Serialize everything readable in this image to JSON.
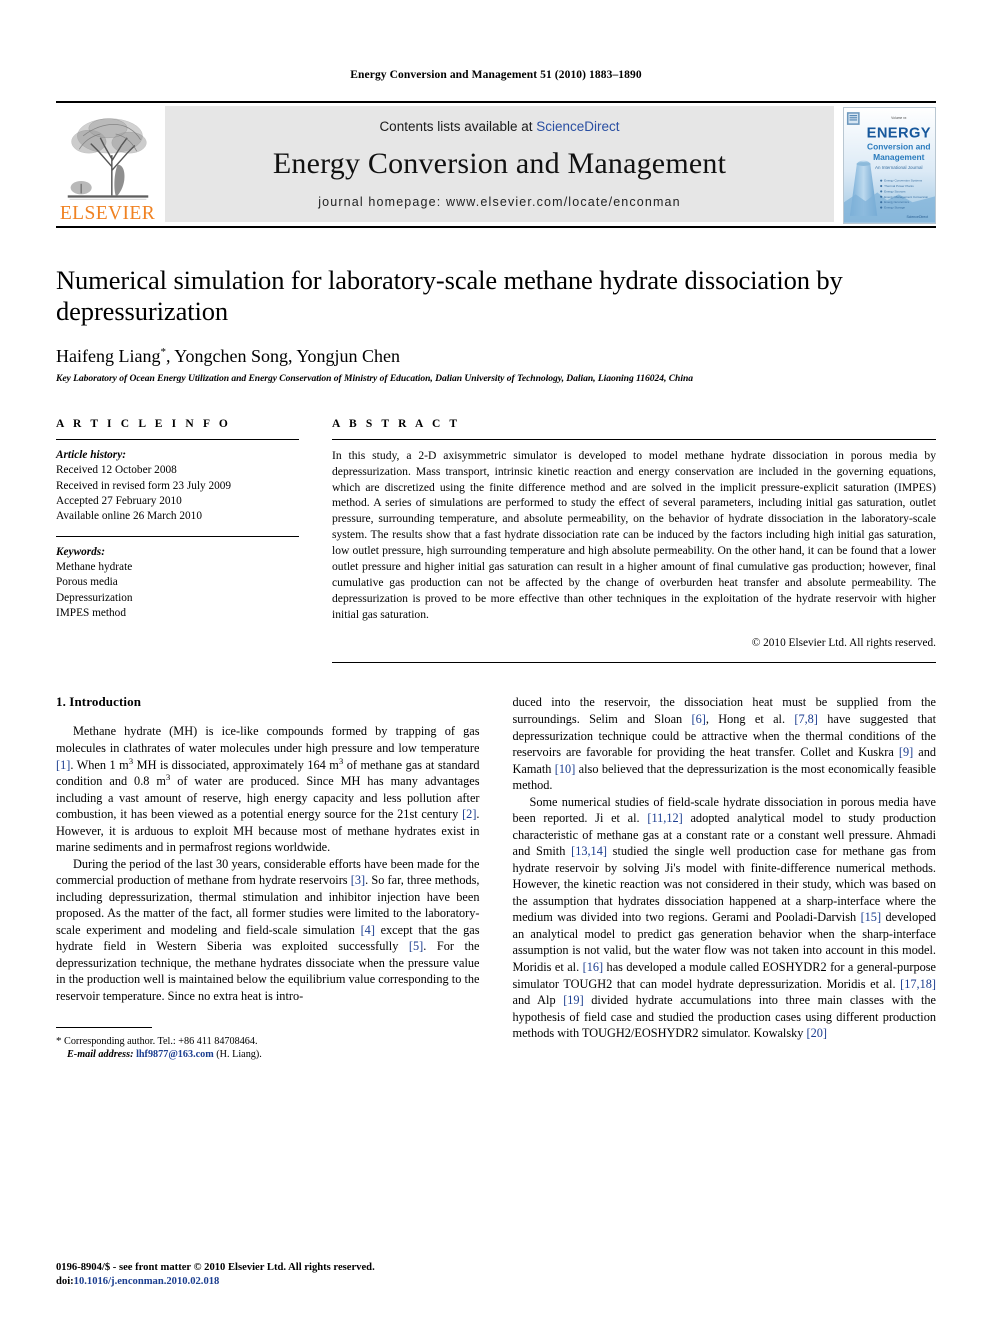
{
  "running_head": "Energy Conversion and Management 51 (2010) 1883–1890",
  "masthead": {
    "publisher_name": "ELSEVIER",
    "contents_prefix": "Contents lists available at ",
    "contents_link": "ScienceDirect",
    "journal_title": "Energy Conversion and Management",
    "homepage": "journal homepage: www.elsevier.com/locate/enconman",
    "cover": {
      "top_label": "Volume xx",
      "line1": "ENERGY",
      "line2": "Conversion and",
      "line3": "Management",
      "subtitle": "An International Journal",
      "footer": "ScienceDirect",
      "accent": "#1d6fb8"
    },
    "link_color": "#2a4fa2",
    "elsevier_orange": "#F08222"
  },
  "title": "Numerical simulation for laboratory-scale methane hydrate dissociation by depressurization",
  "authors": "Haifeng Liang",
  "authors_rest": ", Yongchen Song, Yongjun Chen",
  "author_star": "*",
  "affiliation": "Key Laboratory of Ocean Energy Utilization and Energy Conservation of Ministry of Education, Dalian University of Technology, Dalian, Liaoning 116024, China",
  "article_info": {
    "heading": "A R T I C L E   I N F O",
    "history_label": "Article history:",
    "history": [
      "Received 12 October 2008",
      "Received in revised form 23 July 2009",
      "Accepted 27 February 2010",
      "Available online 26 March 2010"
    ],
    "keywords_label": "Keywords:",
    "keywords": [
      "Methane hydrate",
      "Porous media",
      "Depressurization",
      "IMPES method"
    ]
  },
  "abstract": {
    "heading": "A B S T R A C T",
    "text": "In this study, a 2-D axisymmetric simulator is developed to model methane hydrate dissociation in porous media by depressurization. Mass transport, intrinsic kinetic reaction and energy conservation are included in the governing equations, which are discretized using the finite difference method and are solved in the implicit pressure-explicit saturation (IMPES) method. A series of simulations are performed to study the effect of several parameters, including initial gas saturation, outlet pressure, surrounding temperature, and absolute permeability, on the behavior of hydrate dissociation in the laboratory-scale system. The results show that a fast hydrate dissociation rate can be induced by the factors including high initial gas saturation, low outlet pressure, high surrounding temperature and high absolute permeability. On the other hand, it can be found that a lower outlet pressure and higher initial gas saturation can result in a higher amount of final cumulative gas production; however, final cumulative gas production can not be affected by the change of overburden heat transfer and absolute permeability. The depressurization is proved to be more effective than other techniques in the exploitation of the hydrate reservoir with higher initial gas saturation.",
    "copyright": "© 2010 Elsevier Ltd. All rights reserved."
  },
  "section": {
    "number_title": "1. Introduction"
  },
  "left_column": {
    "p1_a": "Methane hydrate (MH) is ice-like compounds formed by trapping of gas molecules in clathrates of water molecules under high pressure and low temperature ",
    "p1_r1": "[1]",
    "p1_b": ". When 1 m",
    "p1_sup1": "3",
    "p1_c": " MH is dissociated, approximately 164 m",
    "p1_sup2": "3",
    "p1_d": " of methane gas at standard condition and 0.8 m",
    "p1_sup3": "3",
    "p1_e": " of water are produced. Since MH has many advantages including a vast amount of reserve, high energy capacity and less pollution after combustion, it has been viewed as a potential energy source for the 21st century ",
    "p1_r2": "[2]",
    "p1_f": ". However, it is arduous to exploit MH because most of methane hydrates exist in marine sediments and in permafrost regions worldwide.",
    "p2_a": "During the period of the last 30 years, considerable efforts have been made for the commercial production of methane from hydrate reservoirs ",
    "p2_r1": "[3]",
    "p2_b": ". So far, three methods, including depressurization, thermal stimulation and inhibitor injection have been proposed. As the matter of the fact, all former studies were limited to the laboratory-scale experiment and modeling and field-scale simulation ",
    "p2_r2": "[4]",
    "p2_c": " except that the gas hydrate field in Western Siberia was exploited successfully ",
    "p2_r3": "[5]",
    "p2_d": ". For the depressurization technique, the methane hydrates dissociate when the pressure value in the production well is maintained below the equilibrium value corresponding to the reservoir temperature. Since no extra heat is intro-"
  },
  "right_column": {
    "p3_a": "duced into the reservoir, the dissociation heat must be supplied from the surroundings. Selim and Sloan ",
    "p3_r1": "[6]",
    "p3_b": ", Hong et al. ",
    "p3_r2": "[7,8]",
    "p3_c": " have suggested that depressurization technique could be attractive when the thermal conditions of the reservoirs are favorable for providing the heat transfer. Collet and Kuskra ",
    "p3_r3": "[9]",
    "p3_d": " and Kamath ",
    "p3_r4": "[10]",
    "p3_e": " also believed that the depressurization is the most economically feasible method.",
    "p4_a": "Some numerical studies of field-scale hydrate dissociation in porous media have been reported. Ji et al. ",
    "p4_r1": "[11,12]",
    "p4_b": " adopted analytical model to study production characteristic of methane gas at a constant rate or a constant well pressure. Ahmadi and Smith ",
    "p4_r2": "[13,14]",
    "p4_c": " studied the single well production case for methane gas from hydrate reservoir by solving Ji's model with finite-difference numerical methods. However, the kinetic reaction was not considered in their study, which was based on the assumption that hydrates dissociation happened at a sharp-interface where the medium was divided into two regions. Gerami and Pooladi-Darvish ",
    "p4_r3": "[15]",
    "p4_d": " developed an analytical model to predict gas generation behavior when the sharp-interface assumption is not valid, but the water flow was not taken into account in this model. Moridis et al. ",
    "p4_r4": "[16]",
    "p4_e": " has developed a module called EOSHYDR2 for a general-purpose simulator TOUGH2 that can model hydrate depressurization. Moridis et al. ",
    "p4_r5": "[17,18]",
    "p4_f": " and Alp ",
    "p4_r6": "[19]",
    "p4_g": " divided hydrate accumulations into three main classes with the hypothesis of field case and studied the production cases using different production methods with TOUGH2/EOSHYDR2 simulator. Kowalsky ",
    "p4_r7": "[20]"
  },
  "footnote": {
    "star": "*",
    "corresponding": "Corresponding author. Tel.: +86 411 84708464.",
    "email_label": "E-mail address:",
    "email": "lhf9877@163.com",
    "email_suffix": "(H. Liang)."
  },
  "imprint": {
    "line1": "0196-8904/$ - see front matter © 2010 Elsevier Ltd. All rights reserved.",
    "doi_label": "doi:",
    "doi": "10.1016/j.enconman.2010.02.018"
  }
}
